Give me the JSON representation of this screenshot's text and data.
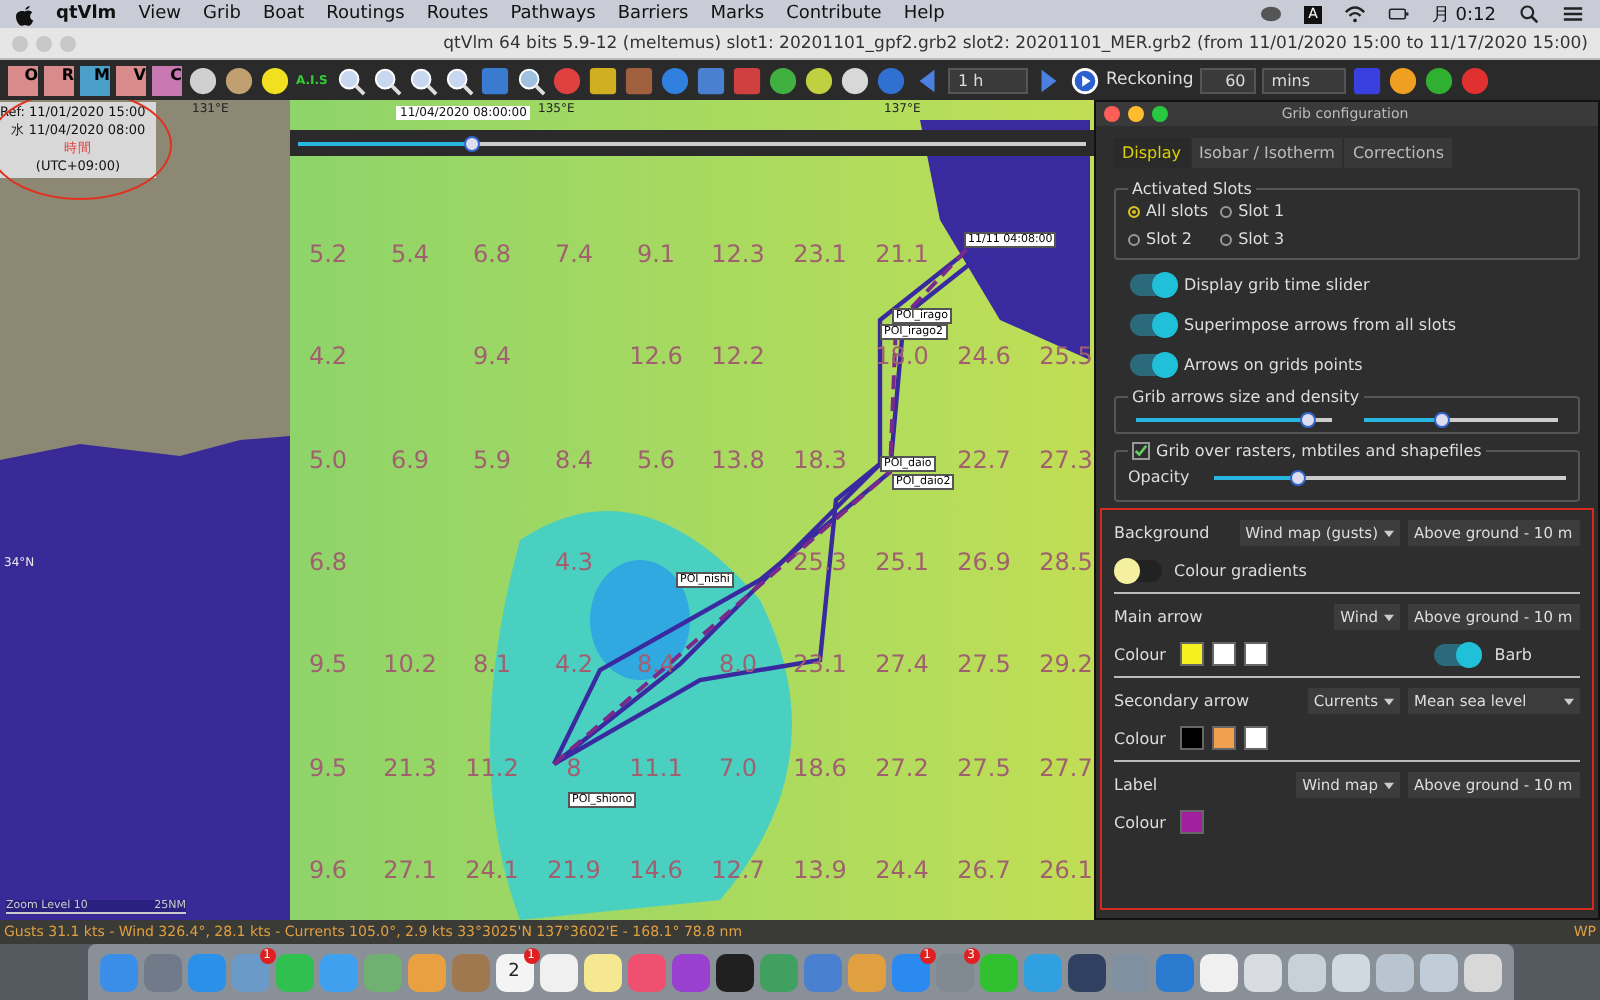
{
  "menu_bar": {
    "app": "qtVlm",
    "items": [
      "View",
      "Grib",
      "Boat",
      "Routings",
      "Routes",
      "Pathways",
      "Barriers",
      "Marks",
      "Contribute",
      "Help"
    ],
    "input_indicator": "A",
    "clock": "月 0:12"
  },
  "window": {
    "title": "qtVlm 64 bits 5.9-12 (meltemus) slot1: 20201101_gpf2.grb2 slot2: 20201101_MER.grb2 (from 11/01/2020 15:00 to 11/17/2020 15:00)"
  },
  "toolbar": {
    "icons": [
      {
        "kind": "tile",
        "label": "O",
        "color": "#d98a8a"
      },
      {
        "kind": "tile",
        "label": "R",
        "color": "#d98a8a"
      },
      {
        "kind": "tile",
        "label": "M",
        "color": "#4aa0c8"
      },
      {
        "kind": "tile",
        "label": "V",
        "color": "#d98a8a"
      },
      {
        "kind": "tile",
        "label": "C",
        "color": "#c878b0"
      },
      {
        "kind": "dot",
        "color": "#d0d0d0"
      },
      {
        "kind": "dot",
        "color": "#c0a070"
      },
      {
        "kind": "dot",
        "color": "#f0e020"
      },
      {
        "kind": "ais",
        "label": "A.I.S"
      },
      {
        "kind": "magnifier",
        "color": "#c8d8f0"
      },
      {
        "kind": "magnifier",
        "color": "#c8d8f0"
      },
      {
        "kind": "magnifier",
        "color": "#c8d8f0"
      },
      {
        "kind": "magnifier",
        "color": "#c8d8f0"
      },
      {
        "kind": "block",
        "color": "#3a7ad0"
      },
      {
        "kind": "magnifier",
        "color": "#a0c0e0"
      },
      {
        "kind": "dot",
        "color": "#e04040"
      },
      {
        "kind": "block",
        "color": "#d0b020"
      },
      {
        "kind": "block",
        "color": "#a06040"
      },
      {
        "kind": "dot",
        "color": "#3080e0"
      },
      {
        "kind": "block",
        "color": "#4a80d0"
      },
      {
        "kind": "block",
        "color": "#d04040"
      },
      {
        "kind": "dot",
        "color": "#40b040"
      },
      {
        "kind": "dot",
        "color": "#c0d040"
      },
      {
        "kind": "dot",
        "color": "#d8d8d8"
      },
      {
        "kind": "dot",
        "color": "#3070d0"
      }
    ],
    "step": "1 h",
    "reckoning": "Reckoning",
    "reckon_value": "60",
    "unit": "mins",
    "end_icons": [
      {
        "kind": "block",
        "color": "#3a40e0"
      },
      {
        "kind": "dot",
        "color": "#f0a020"
      },
      {
        "kind": "dot",
        "color": "#30b030"
      },
      {
        "kind": "dot",
        "color": "#e03030"
      }
    ]
  },
  "map": {
    "lon_labels": [
      "131°E",
      "135°E",
      "137°E"
    ],
    "lat_labels": [
      "34°N"
    ],
    "info": {
      "ref": "Ref: 11/01/2020 15:00",
      "local_time": "水 11/04/2020 08:00",
      "note": "時間",
      "timezone": "(UTC+09:00)"
    },
    "time_slider": {
      "label": "11/04/2020 08:00:00",
      "level": 0.22
    },
    "grid_labels": [
      {
        "column_1": "5.2",
        "column_2": "5.4",
        "column_3": "6.8",
        "column_4": "7.4",
        "column_5": "9.1",
        "column_6": "12.3",
        "column_7": "23.1",
        "column_8": "21.1"
      },
      {
        "column_1": "4.2",
        "column_3": "9.4",
        "column_5": "12.6",
        "column_6": "12.2",
        "column_8": "18.0",
        "column_9": "24.6",
        "column_10": "25.5"
      },
      {
        "column_1": "5.0",
        "column_2": "6.9",
        "column_3": "5.9",
        "column_4": "8.4",
        "column_5": "5.6",
        "column_6": "13.8",
        "column_7": "18.3",
        "column_9": "22.7",
        "column_10": "27.3"
      },
      {
        "column_1": "6.8",
        "column_4": "4.3",
        "column_7": "25.3",
        "column_8": "25.1",
        "column_9": "26.9",
        "column_10": "28.5"
      },
      {
        "column_1": "9.5",
        "column_2": "10.2",
        "column_3": "8.1",
        "column_4": "4.2",
        "column_5": "8.4",
        "column_6": "8.0",
        "column_7": "23.1",
        "column_8": "27.4",
        "column_9": "27.5",
        "column_10": "29.2"
      },
      {
        "column_1": "9.5",
        "column_2": "21.3",
        "column_3": "11.2",
        "column_4": "8",
        "column_5": "11.1",
        "column_6": "7.0",
        "column_7": "18.6",
        "column_8": "27.2",
        "column_9": "27.5",
        "column_10": "27.7"
      },
      {
        "column_1": "9.6",
        "column_2": "27.1",
        "column_3": "24.1",
        "column_4": "21.9",
        "column_5": "14.6",
        "column_6": "12.7",
        "column_7": "13.9",
        "column_8": "24.4",
        "column_9": "26.7",
        "column_10": "26.1"
      }
    ],
    "markers": [
      "11/11 04:08:00",
      "POI_irago",
      "POI_irago2",
      "POI_daio",
      "POI_daio2",
      "POI_nishi",
      "POI_shiono"
    ],
    "zoom_level": "Zoom Level 10",
    "scale": "25NM"
  },
  "grib_config": {
    "title": "Grib configuration",
    "tabs": [
      {
        "label": "Display",
        "selected": true
      },
      {
        "label": "Isobar / Isotherm",
        "selected": false
      },
      {
        "label": "Corrections",
        "selected": false
      }
    ],
    "slots": {
      "title": "Activated Slots",
      "options": [
        {
          "label": "All slots",
          "selected": true
        },
        {
          "label": "Slot 1",
          "selected": false
        },
        {
          "label": "Slot 2",
          "selected": false
        },
        {
          "label": "Slot 3",
          "selected": false
        }
      ]
    },
    "toggles": [
      {
        "label": "Display grib time slider",
        "on": true
      },
      {
        "label": "Superimpose arrows from all slots",
        "on": true
      },
      {
        "label": "Arrows on grids points",
        "on": true
      }
    ],
    "arrows_group": {
      "title": "Grib arrows size and density",
      "sliders": [
        {
          "level": 0.88
        },
        {
          "level": 0.4
        }
      ]
    },
    "overlay_group": {
      "label": "Grib over rasters,  mbtiles and shapefiles",
      "checked": true,
      "opacity": {
        "label": "Opacity",
        "level": 0.24
      }
    },
    "sections": [
      {
        "label": "Background",
        "selects": [
          "Wind map (gusts)",
          "Above ground - 10 m"
        ],
        "toggle": {
          "label": "Colour gradients",
          "on": false
        }
      },
      {
        "label": "Main arrow",
        "selects": [
          "Wind",
          "Above ground - 10 m"
        ],
        "colour_label": "Colour",
        "colours": [
          {
            "color": "#f5f020"
          },
          {
            "color": "#ffffff"
          },
          {
            "color": "#ffffff"
          }
        ],
        "toggle": {
          "label": "Barb",
          "on": true
        }
      },
      {
        "label": "Secondary arrow",
        "selects": [
          "Currents",
          "Mean sea level"
        ],
        "colour_label": "Colour",
        "colours": [
          {
            "color": "#000000"
          },
          {
            "color": "#f0a050"
          },
          {
            "color": "#ffffff"
          }
        ]
      },
      {
        "label": "Label",
        "selects": [
          "Wind map",
          "Above ground - 10 m"
        ],
        "colour_label": "Colour",
        "colours": [
          {
            "color": "#a020a0"
          }
        ]
      }
    ]
  },
  "status_bar": {
    "text": "Gusts 31.1 kts - Wind 326.4°, 28.1 kts - Currents 105.0°, 2.9 kts 33°3025'N 137°3602'E - 168.1° 78.8 nm",
    "right": "WP"
  },
  "dock": {
    "items": [
      {
        "color": "#3a8ee8"
      },
      {
        "color": "#707a88"
      },
      {
        "color": "#2a90e8"
      },
      {
        "color": "#6a9ac8",
        "badge": "1"
      },
      {
        "color": "#30c050"
      },
      {
        "color": "#40a0f0"
      },
      {
        "color": "#70b070"
      },
      {
        "color": "#e8a040"
      },
      {
        "color": "#a07850"
      },
      {
        "color": "#f4f4f4",
        "badge": "1",
        "label": "2"
      },
      {
        "color": "#f0f0f0"
      },
      {
        "color": "#f6e890"
      },
      {
        "color": "#f05070"
      },
      {
        "color": "#9a40d0"
      },
      {
        "color": "#202020"
      },
      {
        "color": "#40a060"
      },
      {
        "color": "#4a80d0"
      },
      {
        "color": "#e0a040"
      },
      {
        "color": "#2a8af0",
        "badge": "1"
      },
      {
        "color": "#808890",
        "badge": "3"
      },
      {
        "color": "#30c030"
      },
      {
        "color": "#30a0e0"
      },
      {
        "color": "#304060"
      },
      {
        "color": "#8090a0"
      },
      {
        "color": "#2a7ad0"
      },
      {
        "color": "#f0f0f0"
      },
      {
        "color": "#d8dce0"
      },
      {
        "color": "#c8d0d8"
      },
      {
        "color": "#d0d8e0"
      },
      {
        "color": "#b8c4d0"
      },
      {
        "color": "#c0ccd8"
      },
      {
        "color": "#d8d8d8"
      }
    ]
  }
}
